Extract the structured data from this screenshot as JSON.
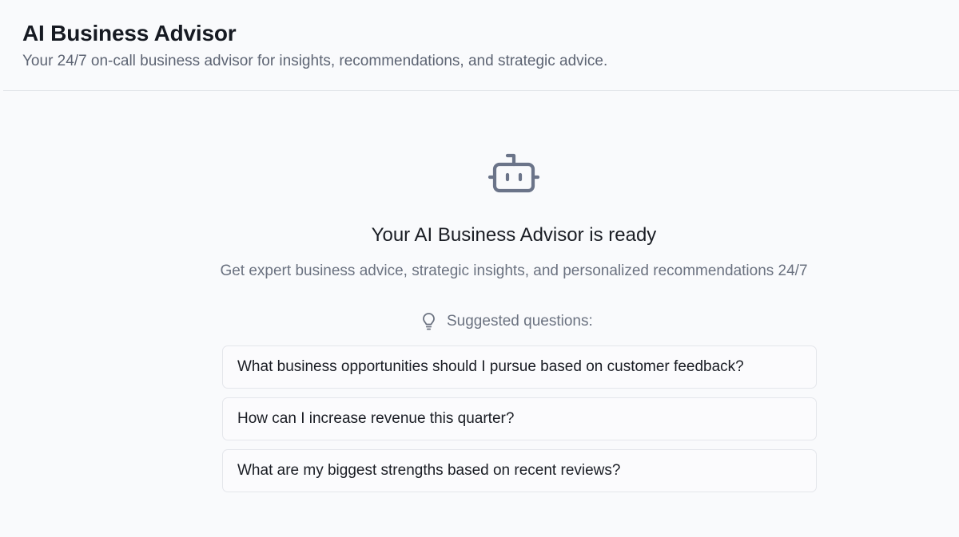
{
  "header": {
    "title": "AI Business Advisor",
    "subtitle": "Your 24/7 on-call business advisor for insights, recommendations, and strategic advice."
  },
  "empty_state": {
    "icon": "bot-icon",
    "heading": "Your AI Business Advisor is ready",
    "description": "Get expert business advice, strategic insights, and personalized recommendations 24/7",
    "suggestions_icon": "lightbulb-icon",
    "suggestions_label": "Suggested questions:",
    "suggestions": [
      "What business opportunities should I pursue based on customer feedback?",
      "How can I increase revenue this quarter?",
      "What are my biggest strengths based on recent reviews?"
    ]
  },
  "colors": {
    "background": "#f9fafc",
    "icon": "#6b7489",
    "muted_text": "#6b7280",
    "border": "#e4e6eb"
  }
}
